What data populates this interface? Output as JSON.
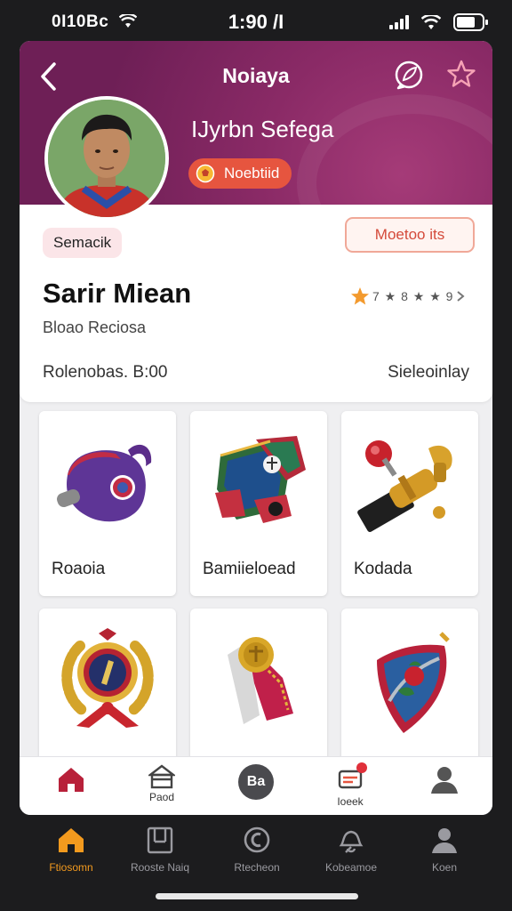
{
  "status_bar": {
    "carrier": "0I10Bc",
    "time": "1:90 /I"
  },
  "header": {
    "title": "Noiaya",
    "player_name": "IJyrbn Sefega",
    "badge_label": "Noebtiid"
  },
  "info": {
    "chip": "Semacik",
    "action_button": "Moetoo its",
    "title": "Sarir Miean",
    "rating_text": "7 ★ 8 ★ ★ 9",
    "subtitle": "Bloao Reciosa",
    "meta_left": "Rolenobas.  B:00",
    "meta_right": "Sieleoinlay"
  },
  "grid": {
    "items": [
      {
        "label": "Roaoia",
        "icon": "bag-icon"
      },
      {
        "label": "Bamiieloead",
        "icon": "banner-icon"
      },
      {
        "label": "Kodada",
        "icon": "trophy-icon"
      },
      {
        "label": "",
        "icon": "medal-wreath-icon"
      },
      {
        "label": "",
        "icon": "ribbon-medal-icon"
      },
      {
        "label": "",
        "icon": "shield-icon"
      }
    ]
  },
  "inner_tabs": [
    {
      "label": "",
      "icon": "home-icon"
    },
    {
      "label": "Paod",
      "icon": "store-icon"
    },
    {
      "label": "Ba",
      "icon": "center-icon"
    },
    {
      "label": "Ioeek",
      "icon": "inbox-icon"
    },
    {
      "label": "",
      "icon": "profile-icon"
    }
  ],
  "bottom_nav": [
    {
      "label": "Ftiosomn",
      "icon": "home-icon"
    },
    {
      "label": "Rooste Naiq",
      "icon": "grid-icon"
    },
    {
      "label": "Rtecheon",
      "icon": "rocket-icon"
    },
    {
      "label": "Kobeamoe",
      "icon": "bell-icon"
    },
    {
      "label": "Koen",
      "icon": "person-icon"
    }
  ],
  "colors": {
    "header": "#8a2a66",
    "accent": "#e6553f",
    "active_nav": "#f39a1e"
  }
}
